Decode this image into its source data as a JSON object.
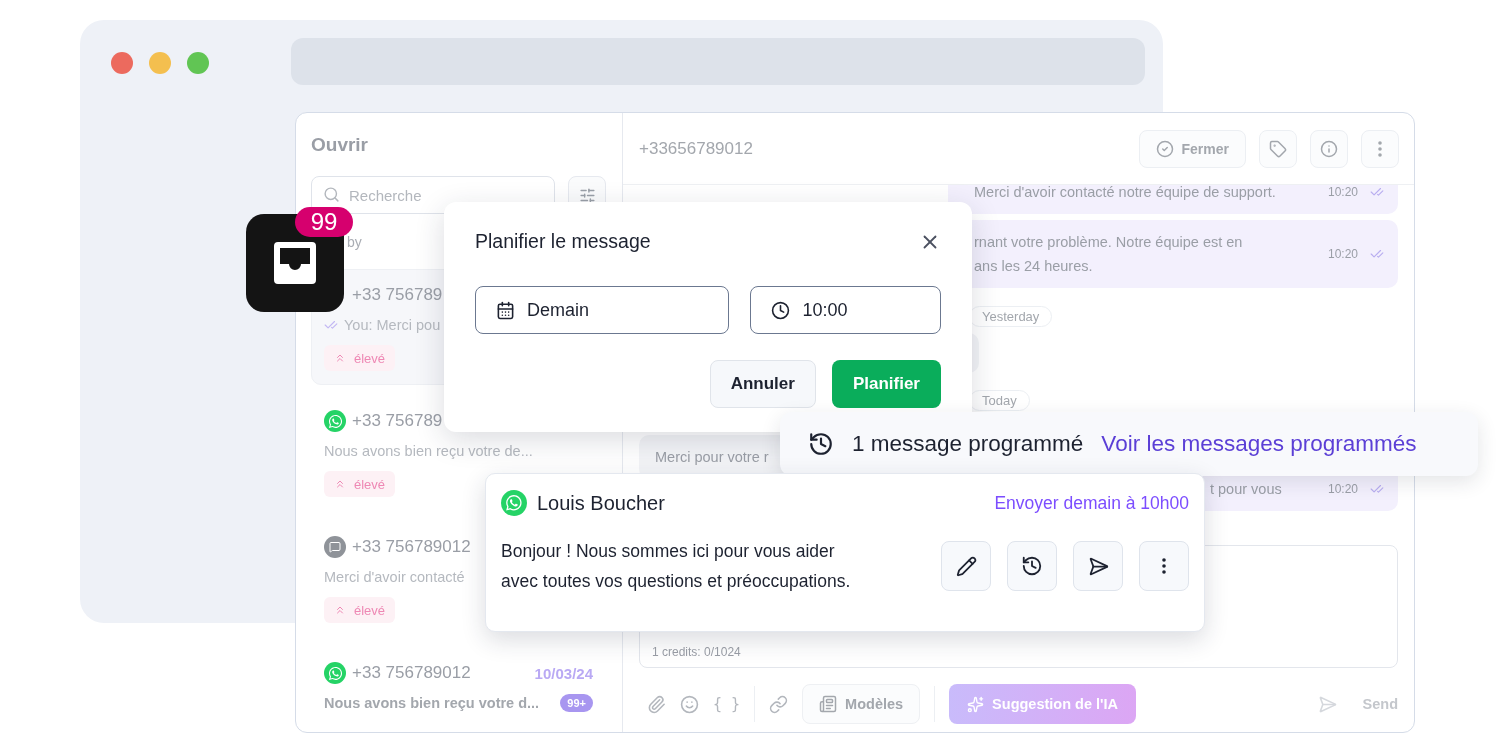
{
  "sidebar": {
    "title": "Ouvrir",
    "search": {
      "placeholder": "Recherche"
    },
    "sort_label": "by",
    "conversations": [
      {
        "selected": true,
        "phone": "+33 756789",
        "read_receipt": true,
        "preview": "You: Merci pou",
        "preview_bold": false,
        "tag": "élevé"
      },
      {
        "selected": false,
        "kind": "whatsapp",
        "phone": "+33 756789",
        "read_receipt": false,
        "preview": "Nous avons bien reçu votre de...",
        "preview_bold": false,
        "tag": "élevé"
      },
      {
        "selected": false,
        "kind": "sms",
        "phone": "+33 756789012",
        "read_receipt": false,
        "preview": "Merci d'avoir contacté",
        "preview_bold": false,
        "tag": "élevé"
      },
      {
        "selected": false,
        "kind": "whatsapp",
        "phone": "+33 756789012",
        "date": "10/03/24",
        "read_receipt": false,
        "preview": "Nous avons bien reçu votre d...",
        "preview_bold": true,
        "unread": "99+"
      }
    ]
  },
  "chat": {
    "phone": "+33656789012",
    "close_button": "Fermer",
    "messages": [
      {
        "kind": "outgoing",
        "lines": [
          "Merci d'avoir contacté notre équipe de support."
        ],
        "time": "10:20"
      },
      {
        "kind": "outgoing",
        "lines": [
          "rnant votre problème. Notre équipe est en",
          "ans les 24 heures."
        ],
        "time": "10:20"
      },
      {
        "kind": "date",
        "label": "Yesterday"
      },
      {
        "kind": "incoming"
      },
      {
        "kind": "date",
        "label": "Today"
      },
      {
        "kind": "incoming",
        "lines": [
          "Merci pour votre r"
        ]
      },
      {
        "kind": "outgoing",
        "lines": [
          "t pour vous"
        ],
        "time": "10:20"
      }
    ],
    "composer": {
      "credits": "1 credits: 0/1024"
    },
    "toolbar": {
      "variables": "{ }",
      "templates": "Modèles",
      "ai_suggestion": "Suggestion de l'IA",
      "send": "Send"
    }
  },
  "app_icon": {
    "badge": "99"
  },
  "dialog": {
    "title": "Planifier le message",
    "date": "Demain",
    "time": "10:00",
    "cancel": "Annuler",
    "confirm": "Planifier"
  },
  "banner": {
    "text": "1 message programmé",
    "link": "Voir les messages programmés"
  },
  "scheduled_message": {
    "kind": "whatsapp",
    "name": "Louis Boucher",
    "schedule": "Envoyer demain à 10h00",
    "lines": [
      "Bonjour ! Nous sommes ici pour vous aider",
      "avec toutes vos questions et préoccupations."
    ]
  }
}
